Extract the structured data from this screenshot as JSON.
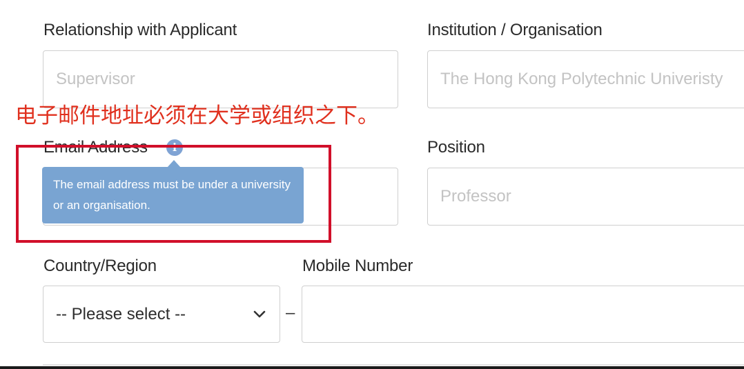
{
  "form": {
    "relationship": {
      "label": "Relationship with Applicant",
      "placeholder": "Supervisor"
    },
    "institution": {
      "label": "Institution / Organisation",
      "placeholder": "The Hong Kong Polytechnic Univeristy"
    },
    "email": {
      "label": "Email Address",
      "placeholder": "",
      "info_icon": "i",
      "tooltip": "The email address must be under a university or an organisation."
    },
    "position": {
      "label": "Position",
      "placeholder": "Professor"
    },
    "country": {
      "label": "Country/Region",
      "selected": "-- Please select --"
    },
    "separator": "–",
    "mobile": {
      "label": "Mobile Number",
      "placeholder": ""
    }
  },
  "annotation": {
    "text": "电子邮件地址必须在大学或组织之下。",
    "color": "#e0301e",
    "box_color": "#d10f2a"
  },
  "icons": {
    "info": "info-icon",
    "chevron": "chevron-down-icon"
  },
  "colors": {
    "tooltip_bg": "#79a4d2",
    "border": "#cfcfcf",
    "placeholder": "#c3c3c3"
  }
}
